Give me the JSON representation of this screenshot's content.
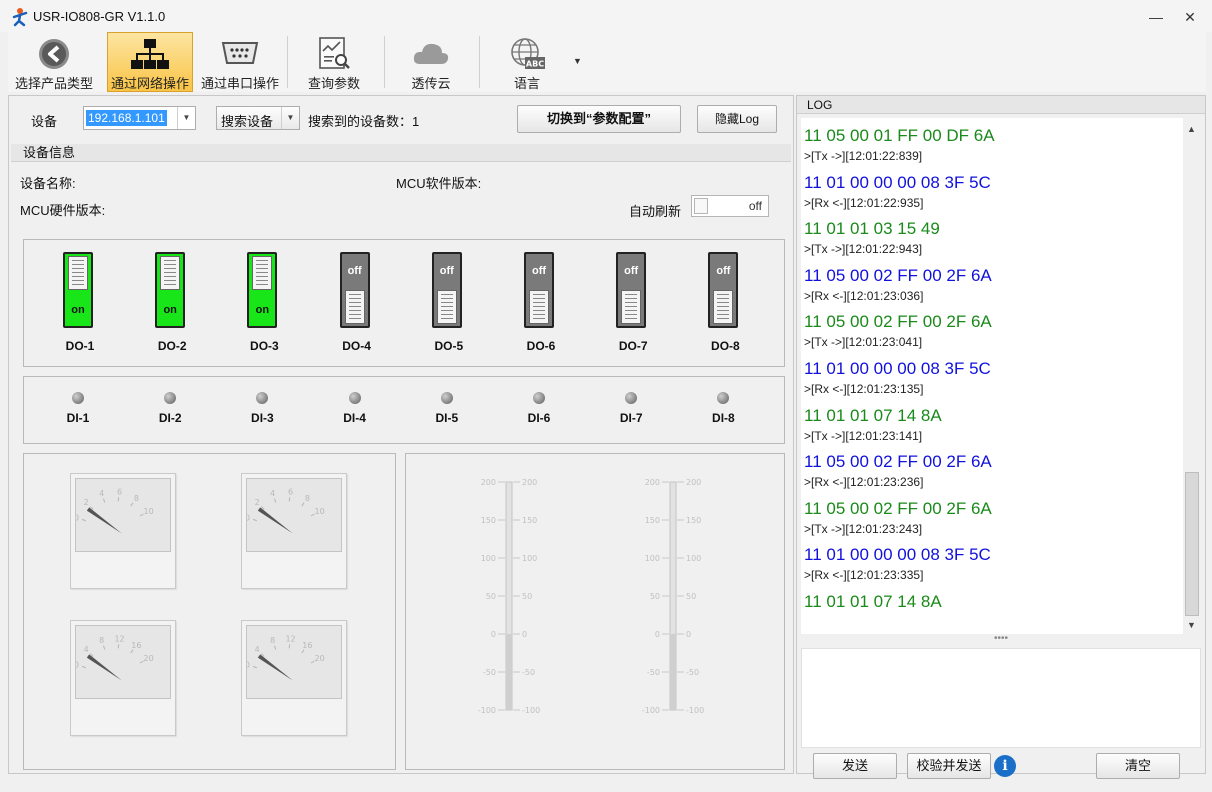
{
  "window": {
    "title": "USR-IO808-GR V1.1.0",
    "minimize_icon": "minimize-icon",
    "close_icon": "close-icon"
  },
  "toolbar": {
    "items": [
      {
        "label": "选择产品类型",
        "icon": "back-arrow-icon"
      },
      {
        "label": "通过网络操作",
        "icon": "network-icon",
        "active": true
      },
      {
        "label": "通过串口操作",
        "icon": "serial-port-icon"
      },
      {
        "label": "查询参数",
        "icon": "query-chart-icon"
      },
      {
        "label": "透传云",
        "icon": "cloud-icon"
      },
      {
        "label": "语言",
        "icon": "language-globe-icon",
        "badge": "ABC"
      }
    ],
    "active_color": "#f9c447"
  },
  "device_bar": {
    "device_label": "设备",
    "device_ip": "192.168.1.101",
    "search_button": "搜索设备",
    "found_label": "搜索到的设备数：1",
    "switch_button": "切换到“参数配置”",
    "hide_log_button": "隐藏Log"
  },
  "device_info": {
    "title": "设备信息",
    "name_label": "设备名称:",
    "mcu_sw_label": "MCU软件版本:",
    "mcu_hw_label": "MCU硬件版本:",
    "auto_refresh_label": "自动刷新",
    "auto_refresh_state": "off"
  },
  "outputs": [
    {
      "label": "DO-1",
      "state": "on"
    },
    {
      "label": "DO-2",
      "state": "on"
    },
    {
      "label": "DO-3",
      "state": "on"
    },
    {
      "label": "DO-4",
      "state": "off"
    },
    {
      "label": "DO-5",
      "state": "off"
    },
    {
      "label": "DO-6",
      "state": "off"
    },
    {
      "label": "DO-7",
      "state": "off"
    },
    {
      "label": "DO-8",
      "state": "off"
    }
  ],
  "inputs": [
    {
      "label": "DI-1"
    },
    {
      "label": "DI-2"
    },
    {
      "label": "DI-3"
    },
    {
      "label": "DI-4"
    },
    {
      "label": "DI-5"
    },
    {
      "label": "DI-6"
    },
    {
      "label": "DI-7"
    },
    {
      "label": "DI-8"
    }
  ],
  "gauges": [
    {
      "max": 10,
      "ticks": [
        "0",
        "2",
        "4",
        "6",
        "8",
        "10"
      ],
      "value": 0
    },
    {
      "max": 10,
      "ticks": [
        "0",
        "2",
        "4",
        "6",
        "8",
        "10"
      ],
      "value": 0
    },
    {
      "max": 20,
      "ticks": [
        "0",
        "4",
        "8",
        "12",
        "16",
        "20"
      ],
      "value": 0
    },
    {
      "max": 20,
      "ticks": [
        "0",
        "4",
        "8",
        "12",
        "16",
        "20"
      ],
      "value": 0
    }
  ],
  "bars": [
    {
      "ticks": [
        "200",
        "150",
        "100",
        "50",
        "0",
        "-50",
        "-100"
      ],
      "value": 0
    },
    {
      "ticks": [
        "200",
        "150",
        "100",
        "50",
        "0",
        "-50",
        "-100"
      ],
      "value": 0
    }
  ],
  "log": {
    "title": "LOG",
    "lines": [
      {
        "kind": "hex",
        "dir": "rx",
        "text": "11 05 00 01 FF 00 DF 6A"
      },
      {
        "kind": "meta",
        "text": ">[Tx ->][12:01:22:839]"
      },
      {
        "kind": "hex",
        "dir": "tx",
        "text": "11 01 00 00 00 08 3F 5C"
      },
      {
        "kind": "meta",
        "text": ">[Rx <-][12:01:22:935]"
      },
      {
        "kind": "hex",
        "dir": "rx",
        "text": "11 01 01 03 15 49"
      },
      {
        "kind": "meta",
        "text": ">[Tx ->][12:01:22:943]"
      },
      {
        "kind": "hex",
        "dir": "tx",
        "text": "11 05 00 02 FF 00 2F 6A"
      },
      {
        "kind": "meta",
        "text": ">[Rx <-][12:01:23:036]"
      },
      {
        "kind": "hex",
        "dir": "rx",
        "text": "11 05 00 02 FF 00 2F 6A"
      },
      {
        "kind": "meta",
        "text": ">[Tx ->][12:01:23:041]"
      },
      {
        "kind": "hex",
        "dir": "tx",
        "text": "11 01 00 00 00 08 3F 5C"
      },
      {
        "kind": "meta",
        "text": ">[Rx <-][12:01:23:135]"
      },
      {
        "kind": "hex",
        "dir": "rx",
        "text": "11 01 01 07 14 8A"
      },
      {
        "kind": "meta",
        "text": ">[Tx ->][12:01:23:141]"
      },
      {
        "kind": "hex",
        "dir": "tx",
        "text": "11 05 00 02 FF 00 2F 6A"
      },
      {
        "kind": "meta",
        "text": ">[Rx <-][12:01:23:236]"
      },
      {
        "kind": "hex",
        "dir": "rx",
        "text": "11 05 00 02 FF 00 2F 6A"
      },
      {
        "kind": "meta",
        "text": ">[Tx ->][12:01:23:243]"
      },
      {
        "kind": "hex",
        "dir": "tx",
        "text": "11 01 00 00 00 08 3F 5C"
      },
      {
        "kind": "meta",
        "text": ">[Rx <-][12:01:23:335]"
      },
      {
        "kind": "hex",
        "dir": "rx",
        "text": "11 01 01 07 14 8A"
      }
    ],
    "tx_color": "#1111dd",
    "rx_color": "#1a8a1a",
    "send_button": "发送",
    "verify_send_button": "校验并发送",
    "clear_button": "清空"
  }
}
